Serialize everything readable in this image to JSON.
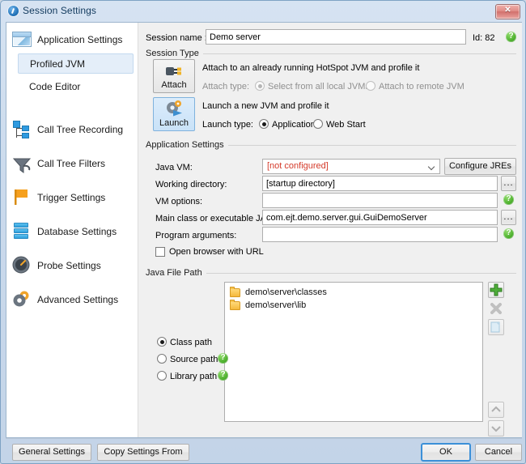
{
  "window": {
    "title": "Session Settings",
    "icon": "app-logo-icon",
    "close_label": "✕"
  },
  "sidebar": {
    "items": [
      {
        "label": "Application Settings",
        "icon": "window-icon",
        "selected": false,
        "sub": false
      },
      {
        "label": "Profiled JVM",
        "icon": "none",
        "selected": true,
        "sub": true
      },
      {
        "label": "Code Editor",
        "icon": "none",
        "selected": false,
        "sub": true
      },
      {
        "label": "Call Tree Recording",
        "icon": "tree-icon",
        "selected": false,
        "sub": false
      },
      {
        "label": "Call Tree Filters",
        "icon": "funnel-icon",
        "selected": false,
        "sub": false
      },
      {
        "label": "Trigger Settings",
        "icon": "flag-icon",
        "selected": false,
        "sub": false
      },
      {
        "label": "Database Settings",
        "icon": "database-icon",
        "selected": false,
        "sub": false
      },
      {
        "label": "Probe Settings",
        "icon": "gauge-icon",
        "selected": false,
        "sub": false
      },
      {
        "label": "Advanced Settings",
        "icon": "gears-icon",
        "selected": false,
        "sub": false
      }
    ]
  },
  "session": {
    "name_label": "Session name :",
    "name_value": "Demo server",
    "id_label": "Id:  82",
    "help_icon": "help-icon"
  },
  "session_type": {
    "group_title": "Session Type",
    "attach": {
      "button_label": "Attach",
      "icon": "plug-icon",
      "description": "Attach to an already running HotSpot JVM and profile it",
      "type_label": "Attach type:",
      "options": [
        {
          "label": "Select from all local JVMs",
          "selected": true,
          "disabled": true
        },
        {
          "label": "Attach to remote JVM",
          "selected": false,
          "disabled": true
        }
      ]
    },
    "launch": {
      "button_label": "Launch",
      "icon": "gear-play-icon",
      "description": "Launch a new JVM and profile it",
      "type_label": "Launch type:",
      "options": [
        {
          "label": "Application",
          "selected": true,
          "disabled": false
        },
        {
          "label": "Web Start",
          "selected": false,
          "disabled": false
        }
      ]
    }
  },
  "application_settings": {
    "group_title": "Application Settings",
    "java_vm": {
      "label": "Java VM:",
      "value": "[not configured]",
      "value_color": "#d43a2a",
      "configure_button": "Configure JREs"
    },
    "working_directory": {
      "label": "Working directory:",
      "value": "[startup directory]",
      "browse_button": "..."
    },
    "vm_options": {
      "label": "VM options:",
      "value": "",
      "placeholder": "",
      "help_icon": "help-icon"
    },
    "main_class": {
      "label": "Main class or executable JAR:",
      "value": "com.ejt.demo.server.gui.GuiDemoServer",
      "browse_button": "..."
    },
    "program_arguments": {
      "label": "Program arguments:",
      "value": "",
      "placeholder": "",
      "help_icon": "help-icon"
    },
    "open_browser": {
      "label": "Open browser with URL",
      "checked": false
    }
  },
  "java_file_path": {
    "group_title": "Java File Path",
    "path_modes": [
      {
        "label": "Class path",
        "selected": true,
        "help": false
      },
      {
        "label": "Source path",
        "selected": false,
        "help": true
      },
      {
        "label": "Library path",
        "selected": false,
        "help": true
      }
    ],
    "entries": [
      {
        "icon": "folder-icon",
        "text": "demo\\server\\classes"
      },
      {
        "icon": "folder-icon",
        "text": "demo\\server\\lib"
      }
    ],
    "tools": [
      {
        "name": "add-icon",
        "glyph": "+",
        "enabled": true
      },
      {
        "name": "remove-icon",
        "glyph": "✕",
        "enabled": false
      },
      {
        "name": "edit-icon",
        "glyph": "",
        "enabled": false
      },
      {
        "name": "move-up-icon",
        "glyph": "˄",
        "enabled": false
      },
      {
        "name": "move-down-icon",
        "glyph": "˅",
        "enabled": false
      }
    ]
  },
  "footer": {
    "general_settings": "General Settings",
    "copy_settings_from": "Copy Settings From",
    "ok": "OK",
    "cancel": "Cancel"
  }
}
